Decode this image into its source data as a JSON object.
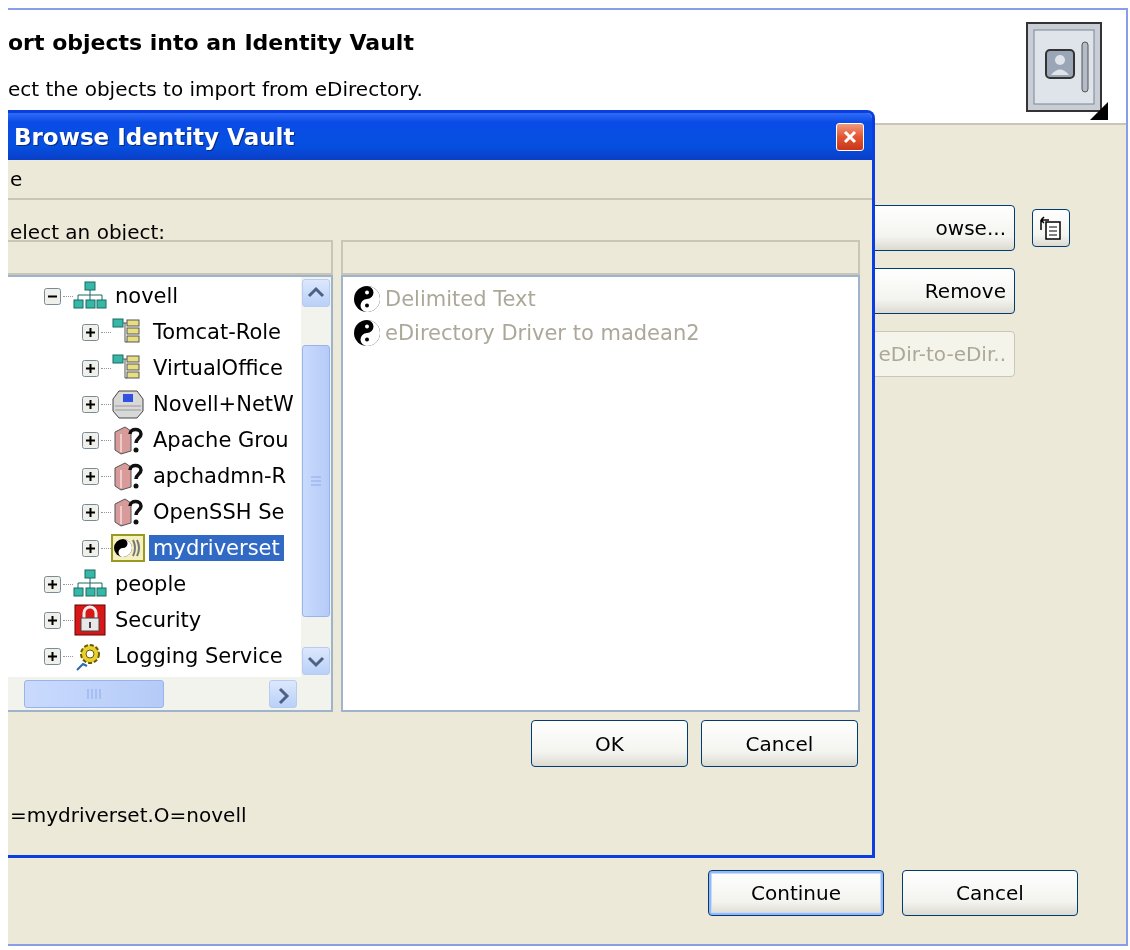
{
  "wizard": {
    "title": "ort objects into an Identity Vault",
    "subtitle": "ect the objects to import from eDirectory.",
    "buttons": [
      {
        "label": "owse...",
        "disabled": false,
        "kind": "browse"
      },
      {
        "label": "Remove",
        "disabled": false,
        "kind": "plain"
      },
      {
        "label": "eDir-to-eDir..",
        "disabled": true,
        "kind": "plain"
      }
    ],
    "footer_buttons": [
      {
        "label": "Continue",
        "default": true
      },
      {
        "label": "Cancel",
        "default": false
      }
    ]
  },
  "dialog": {
    "title": "Browse Identity Vault",
    "menu": [
      "e"
    ],
    "prompt": "elect an object:",
    "tree": [
      {
        "label": "novell",
        "kind": "org",
        "expanded": true,
        "selected": false,
        "children": [
          {
            "label": "Tomcat-Role",
            "kind": "role",
            "expanded": false,
            "selected": false
          },
          {
            "label": "VirtualOffice",
            "kind": "role",
            "expanded": false,
            "selected": false
          },
          {
            "label": "Novell+NetW",
            "kind": "server",
            "expanded": false,
            "selected": false
          },
          {
            "label": "Apache Grou",
            "kind": "unknown",
            "expanded": false,
            "selected": false
          },
          {
            "label": "apchadmn-R",
            "kind": "unknown",
            "expanded": false,
            "selected": false
          },
          {
            "label": "OpenSSH Se",
            "kind": "unknown",
            "expanded": false,
            "selected": false
          },
          {
            "label": "mydriverset",
            "kind": "driverset",
            "expanded": false,
            "selected": true
          }
        ]
      },
      {
        "label": "people",
        "kind": "org",
        "expanded": false,
        "selected": false
      },
      {
        "label": "Security",
        "kind": "lock",
        "expanded": false,
        "selected": false
      },
      {
        "label": "Logging Service",
        "kind": "gear",
        "expanded": false,
        "selected": false
      }
    ],
    "list": [
      {
        "label": "Delimited Text",
        "disabled": true
      },
      {
        "label": "eDirectory Driver to madean2",
        "disabled": true
      }
    ],
    "buttons": [
      "OK",
      "Cancel"
    ],
    "status": "=mydriverset.O=novell"
  }
}
